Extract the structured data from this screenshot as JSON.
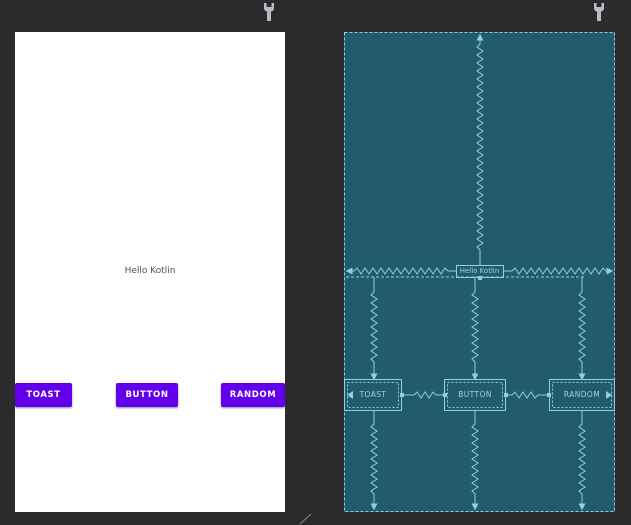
{
  "design": {
    "hello_text": "Hello Kotlin",
    "buttons": {
      "toast": "TOAST",
      "button": "BUTTON",
      "random": "RANDOM"
    }
  },
  "blueprint": {
    "hello_text": "Hello Kotlin",
    "buttons": {
      "toast": "TOAST",
      "button": "BUTTON",
      "random": "RANDOM"
    }
  },
  "icons": {
    "left_toolbar": "wrench-icon",
    "right_toolbar": "wrench-icon"
  },
  "colors": {
    "canvas_background": "#2b2b2d",
    "design_background": "#ffffff",
    "button_primary": "#6200ee",
    "blueprint_background": "#235b6e",
    "blueprint_lines": "#8fd0dc"
  }
}
